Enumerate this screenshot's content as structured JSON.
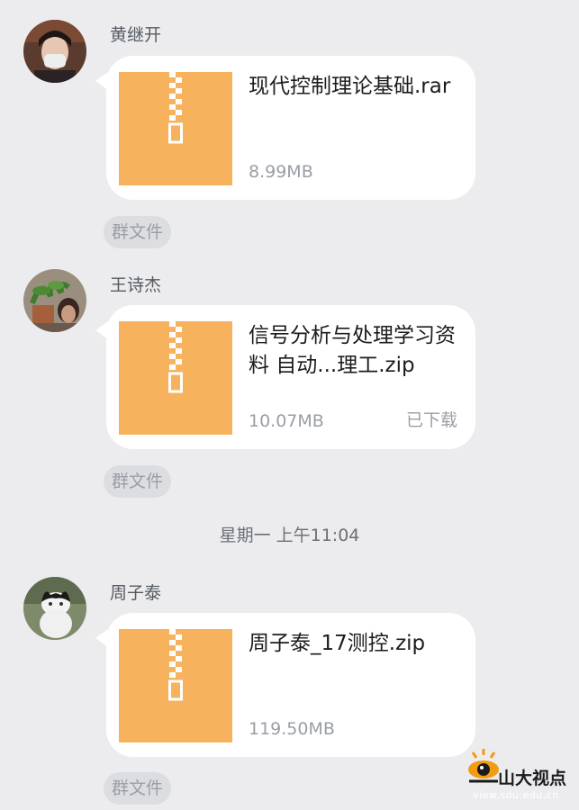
{
  "colors": {
    "background": "#ececef",
    "bubble": "#ffffff",
    "zip_icon": "#f7b25e",
    "tag_bg": "#dcdde1"
  },
  "messages": [
    {
      "sender": "黄继开",
      "file_icon": "zip-icon",
      "file_name": "现代控制理论基础.rar",
      "file_size": "8.99MB",
      "status": "",
      "tag": "群文件"
    },
    {
      "sender": "王诗杰",
      "file_icon": "zip-icon",
      "file_name": "信号分析与处理学习资料 自动...理工.zip",
      "file_size": "10.07MB",
      "status": "已下载",
      "tag": "群文件"
    },
    {
      "sender": "周子泰",
      "file_icon": "zip-icon",
      "file_name": "周子泰_17测控.zip",
      "file_size": "119.50MB",
      "status": "",
      "tag": "群文件"
    }
  ],
  "time_separator": "星期一 上午11:04",
  "watermark": {
    "title": "山大视点",
    "url": "view.sdu.edu.cn"
  }
}
